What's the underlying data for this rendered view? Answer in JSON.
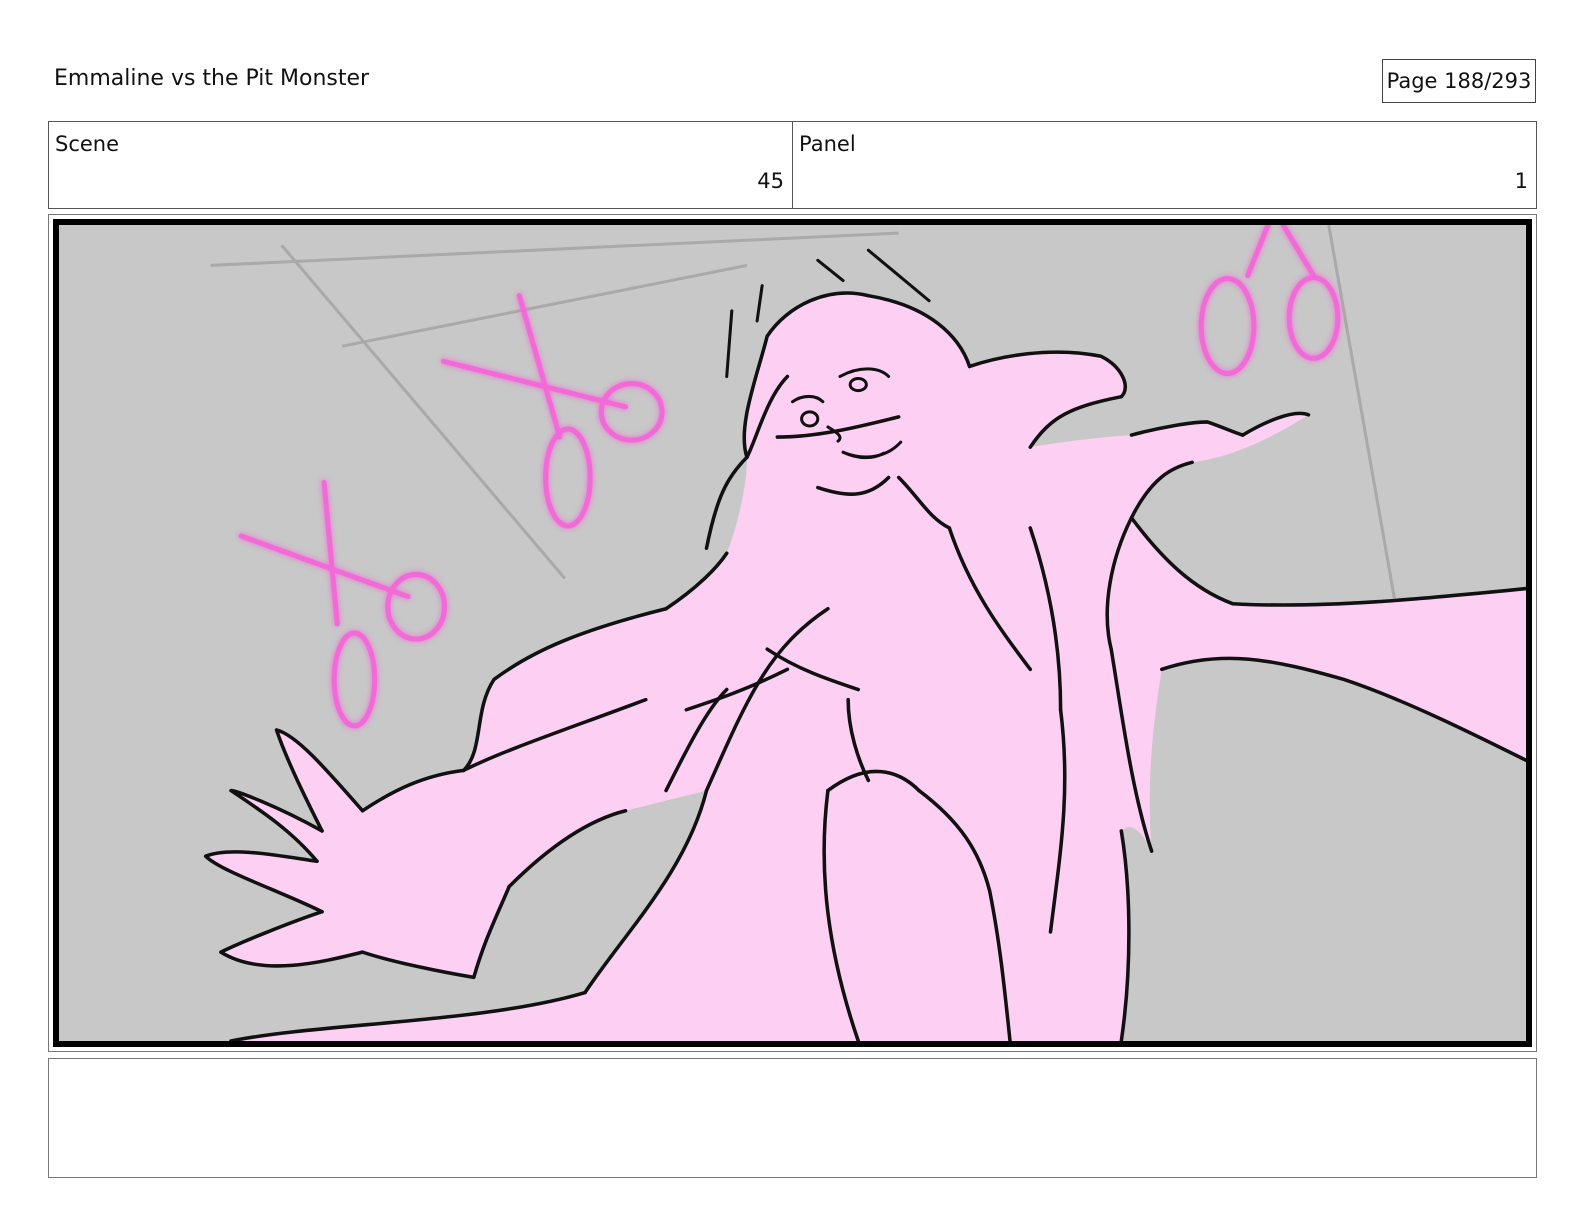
{
  "header": {
    "title": "Emmaline vs the Pit Monster",
    "page": "Page 188/293"
  },
  "info": {
    "scene_label": "Scene",
    "scene_value": "45",
    "panel_label": "Panel",
    "panel_value": "1"
  },
  "panel": {
    "background_color": "#c8c8c8",
    "figure_fill_color": "#fdd0f3",
    "scissors_color": "#f26ad8",
    "line_color": "#111111"
  },
  "notes": {
    "text": ""
  }
}
